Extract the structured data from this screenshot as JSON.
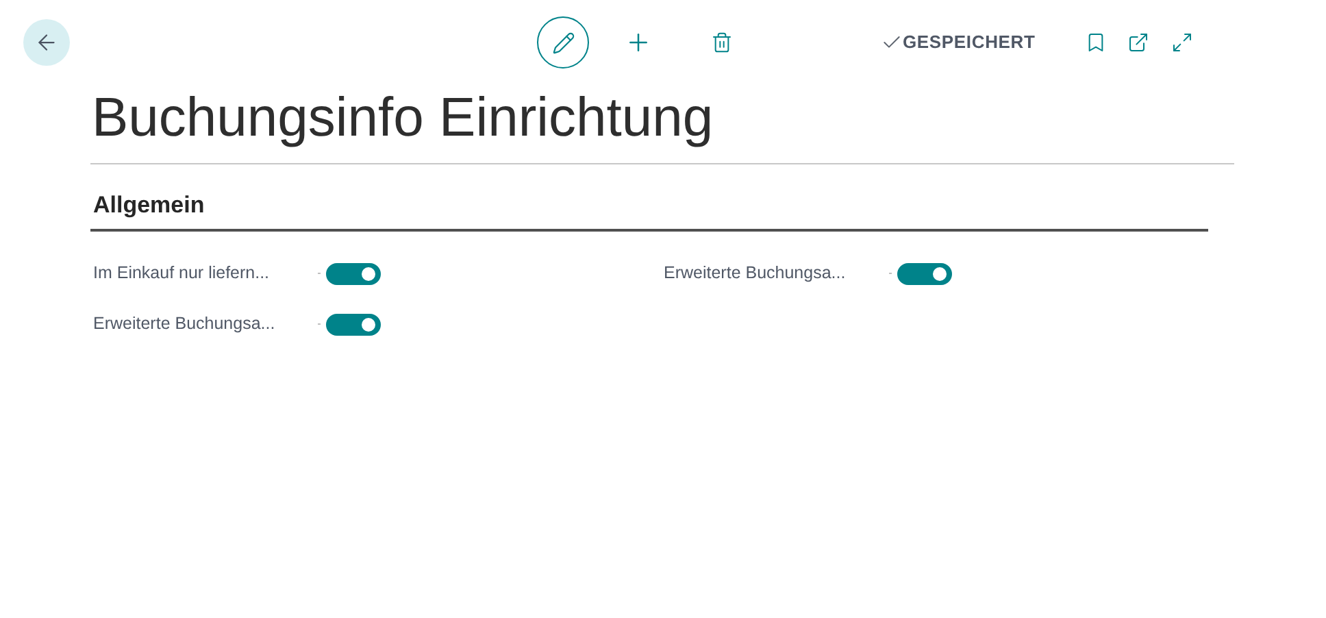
{
  "toolbar": {
    "status": "GESPEICHERT"
  },
  "title": "Buchungsinfo Einrichtung",
  "section": {
    "title": "Allgemein",
    "columns": [
      [
        {
          "label": "Im Einkauf nur liefern...",
          "on": true
        },
        {
          "label": "Erweiterte Buchungsa...",
          "on": true
        }
      ],
      [
        {
          "label": "Erweiterte Buchungsa...",
          "on": true
        }
      ]
    ]
  }
}
